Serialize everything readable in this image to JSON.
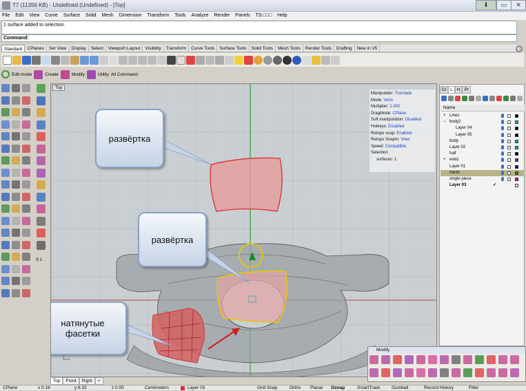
{
  "window": {
    "title": "T7 (11356 KB) - Undefined (Undefined) - [Top]"
  },
  "menu": [
    "File",
    "Edit",
    "View",
    "Curve",
    "Surface",
    "Solid",
    "Mesh",
    "Dimension",
    "Transform",
    "Tools",
    "Analyze",
    "Render",
    "Panels",
    "TS:□□□",
    "Help"
  ],
  "command_history": "1 surface added to selection.",
  "command_prompt": "Command:",
  "toolbar_tabs": [
    "Standard",
    "CPlanes",
    "Set View",
    "Display",
    "Select",
    "Viewport Layout",
    "Visibility",
    "Transform",
    "Curve Tools",
    "Surface Tools",
    "Solid Tools",
    "Mesh Tools",
    "Render Tools",
    "Drafting",
    "New in V5"
  ],
  "toolbar2": {
    "edit_mode": "Edit mode",
    "create": "Create",
    "modify": "Modify",
    "utility": "Utility",
    "all_command": "All Command"
  },
  "viewport": {
    "label": "Top"
  },
  "info_panel": [
    {
      "k": "Manipulator:",
      "v": "Translate"
    },
    {
      "k": "Mode:",
      "v": "Verts"
    },
    {
      "k": "Multiplier:",
      "v": "1.000"
    },
    {
      "k": "DragMode:",
      "v": "CPlane"
    },
    {
      "k": "Soft manipulation:",
      "v": "Disabled"
    },
    {
      "k": "Hotkeys:",
      "v": "Disabled"
    },
    {
      "k": "Retopo snap:",
      "v": "Enabled"
    },
    {
      "k": "Retopo SnapIn:",
      "v": "View"
    },
    {
      "k": "Speed:",
      "v": "Compatible"
    },
    {
      "k": "Selection",
      "v": ""
    },
    {
      "k": "surfaces:",
      "v": "1"
    }
  ],
  "callouts": {
    "c1": "развёртка",
    "c2": "развёртка",
    "c3a": "натянутые",
    "c3b": "фасетки"
  },
  "left_tools_label": "S 1",
  "viewport_tabs": [
    "Top",
    "Front",
    "Right",
    "+"
  ],
  "right_panel": {
    "tabs": [
      "Di",
      "L",
      "H",
      "Pr"
    ],
    "header": "Name",
    "layers": [
      {
        "name": "Lines",
        "color": "#000000",
        "expand": "+"
      },
      {
        "name": "body2",
        "color": "#00c0c0",
        "expand": "−"
      },
      {
        "name": "Layer 04",
        "color": "#000000",
        "expand": ""
      },
      {
        "name": "Layer 05",
        "color": "#000000",
        "expand": ""
      },
      {
        "name": "body",
        "color": "#00c0c0",
        "expand": ""
      },
      {
        "name": "Layer 02",
        "color": "#00c0c0",
        "expand": ""
      },
      {
        "name": "half",
        "color": "#000000",
        "expand": ""
      },
      {
        "name": "eskiz",
        "color": "#7030a0",
        "expand": "+"
      },
      {
        "name": "Layer 01",
        "color": "#00008b",
        "expand": ""
      },
      {
        "name": "mesh",
        "color": "#6b6b35",
        "expand": "",
        "selected": true
      },
      {
        "name": "single piece",
        "color": "#e000e0",
        "expand": ""
      },
      {
        "name": "Layer 03",
        "color": "#ffffff",
        "expand": "",
        "current": true
      }
    ]
  },
  "modify_panel": {
    "title": "Modify"
  },
  "status": {
    "cplane": "CPlane",
    "x": "x 0.18",
    "y": "y 8.32",
    "z": "z 0.00",
    "units": "Centimeters",
    "layer": "Layer 03",
    "grid_snap": "Grid Snap",
    "ortho": "Ortho",
    "planar": "Planar",
    "osnap": "Osnap",
    "smarttrack": "SmartTrack",
    "gumball": "Gumball",
    "record_history": "Record History",
    "filter": "Filter"
  },
  "colors": {
    "surface_red": "#e05050",
    "selection_yellow": "#f0d000",
    "callout_border": "#8aa1c4",
    "red_axis": "#c04040",
    "green_axis": "#30a030"
  }
}
